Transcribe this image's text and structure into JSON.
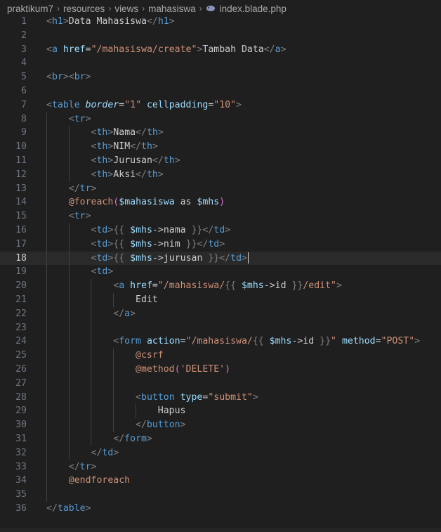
{
  "breadcrumb": {
    "items": [
      "praktikum7",
      "resources",
      "views",
      "mahasiswa"
    ],
    "file": "index.blade.php",
    "file_icon": "php-elephant-icon"
  },
  "editor": {
    "current_line": 18,
    "lines": [
      {
        "n": "1",
        "tokens": [
          [
            "p",
            "<"
          ],
          [
            "t",
            "h1"
          ],
          [
            "p",
            ">"
          ],
          [
            "x",
            "Data Mahasiswa"
          ],
          [
            "p",
            "</"
          ],
          [
            "t",
            "h1"
          ],
          [
            "p",
            ">"
          ]
        ]
      },
      {
        "n": "2",
        "tokens": []
      },
      {
        "n": "3",
        "tokens": [
          [
            "p",
            "<"
          ],
          [
            "t",
            "a"
          ],
          [
            "x",
            " "
          ],
          [
            "a",
            "href"
          ],
          [
            "x",
            "="
          ],
          [
            "s",
            "\"/mahasiswa/create\""
          ],
          [
            "p",
            ">"
          ],
          [
            "x",
            "Tambah Data"
          ],
          [
            "p",
            "</"
          ],
          [
            "t",
            "a"
          ],
          [
            "p",
            ">"
          ]
        ]
      },
      {
        "n": "4",
        "tokens": []
      },
      {
        "n": "5",
        "tokens": [
          [
            "p",
            "<"
          ],
          [
            "t",
            "br"
          ],
          [
            "p",
            "><"
          ],
          [
            "t",
            "br"
          ],
          [
            "p",
            ">"
          ]
        ]
      },
      {
        "n": "6",
        "tokens": []
      },
      {
        "n": "7",
        "tokens": [
          [
            "p",
            "<"
          ],
          [
            "t",
            "table"
          ],
          [
            "x",
            " "
          ],
          [
            "ai",
            "border"
          ],
          [
            "x",
            "="
          ],
          [
            "s",
            "\"1\""
          ],
          [
            "x",
            " "
          ],
          [
            "a",
            "cellpadding"
          ],
          [
            "x",
            "="
          ],
          [
            "s",
            "\"10\""
          ],
          [
            "p",
            ">"
          ]
        ]
      },
      {
        "n": "8",
        "tokens": [
          [
            "x",
            "    "
          ],
          [
            "p",
            "<"
          ],
          [
            "t",
            "tr"
          ],
          [
            "p",
            ">"
          ]
        ]
      },
      {
        "n": "9",
        "tokens": [
          [
            "x",
            "        "
          ],
          [
            "p",
            "<"
          ],
          [
            "t",
            "th"
          ],
          [
            "p",
            ">"
          ],
          [
            "x",
            "Nama"
          ],
          [
            "p",
            "</"
          ],
          [
            "t",
            "th"
          ],
          [
            "p",
            ">"
          ]
        ]
      },
      {
        "n": "10",
        "tokens": [
          [
            "x",
            "        "
          ],
          [
            "p",
            "<"
          ],
          [
            "t",
            "th"
          ],
          [
            "p",
            ">"
          ],
          [
            "x",
            "NIM"
          ],
          [
            "p",
            "</"
          ],
          [
            "t",
            "th"
          ],
          [
            "p",
            ">"
          ]
        ]
      },
      {
        "n": "11",
        "tokens": [
          [
            "x",
            "        "
          ],
          [
            "p",
            "<"
          ],
          [
            "t",
            "th"
          ],
          [
            "p",
            ">"
          ],
          [
            "x",
            "Jurusan"
          ],
          [
            "p",
            "</"
          ],
          [
            "t",
            "th"
          ],
          [
            "p",
            ">"
          ]
        ]
      },
      {
        "n": "12",
        "tokens": [
          [
            "x",
            "        "
          ],
          [
            "p",
            "<"
          ],
          [
            "t",
            "th"
          ],
          [
            "p",
            ">"
          ],
          [
            "x",
            "Aksi"
          ],
          [
            "p",
            "</"
          ],
          [
            "t",
            "th"
          ],
          [
            "p",
            ">"
          ]
        ]
      },
      {
        "n": "13",
        "tokens": [
          [
            "x",
            "    "
          ],
          [
            "p",
            "</"
          ],
          [
            "t",
            "tr"
          ],
          [
            "p",
            ">"
          ]
        ]
      },
      {
        "n": "14",
        "tokens": [
          [
            "x",
            "    "
          ],
          [
            "d",
            "@foreach"
          ],
          [
            "br",
            "("
          ],
          [
            "v",
            "$mahasiswa"
          ],
          [
            "x",
            " as "
          ],
          [
            "v",
            "$mhs"
          ],
          [
            "br",
            ")"
          ]
        ]
      },
      {
        "n": "15",
        "tokens": [
          [
            "x",
            "    "
          ],
          [
            "p",
            "<"
          ],
          [
            "t",
            "tr"
          ],
          [
            "p",
            ">"
          ]
        ]
      },
      {
        "n": "16",
        "tokens": [
          [
            "x",
            "        "
          ],
          [
            "p",
            "<"
          ],
          [
            "t",
            "td"
          ],
          [
            "p",
            ">"
          ],
          [
            "p",
            "{{"
          ],
          [
            "x",
            " "
          ],
          [
            "v",
            "$mhs"
          ],
          [
            "x",
            "->nama "
          ],
          [
            "p",
            "}}"
          ],
          [
            "p",
            "</"
          ],
          [
            "t",
            "td"
          ],
          [
            "p",
            ">"
          ]
        ]
      },
      {
        "n": "17",
        "tokens": [
          [
            "x",
            "        "
          ],
          [
            "p",
            "<"
          ],
          [
            "t",
            "td"
          ],
          [
            "p",
            ">"
          ],
          [
            "p",
            "{{"
          ],
          [
            "x",
            " "
          ],
          [
            "v",
            "$mhs"
          ],
          [
            "x",
            "->nim "
          ],
          [
            "p",
            "}}"
          ],
          [
            "p",
            "</"
          ],
          [
            "t",
            "td"
          ],
          [
            "p",
            ">"
          ]
        ]
      },
      {
        "n": "18",
        "tokens": [
          [
            "x",
            "        "
          ],
          [
            "p",
            "<"
          ],
          [
            "t",
            "td"
          ],
          [
            "p",
            ">"
          ],
          [
            "p",
            "{{"
          ],
          [
            "x",
            " "
          ],
          [
            "v",
            "$mhs"
          ],
          [
            "x",
            "->jurusan "
          ],
          [
            "p",
            "}}"
          ],
          [
            "p",
            "</"
          ],
          [
            "t",
            "td"
          ],
          [
            "p",
            ">"
          ]
        ]
      },
      {
        "n": "19",
        "tokens": [
          [
            "x",
            "        "
          ],
          [
            "p",
            "<"
          ],
          [
            "t",
            "td"
          ],
          [
            "p",
            ">"
          ]
        ]
      },
      {
        "n": "20",
        "tokens": [
          [
            "x",
            "            "
          ],
          [
            "p",
            "<"
          ],
          [
            "t",
            "a"
          ],
          [
            "x",
            " "
          ],
          [
            "a",
            "href"
          ],
          [
            "x",
            "="
          ],
          [
            "s",
            "\"/mahasiswa/"
          ],
          [
            "p",
            "{{"
          ],
          [
            "x",
            " "
          ],
          [
            "v",
            "$mhs"
          ],
          [
            "x",
            "->id "
          ],
          [
            "p",
            "}}"
          ],
          [
            "s",
            "/edit\""
          ],
          [
            "p",
            ">"
          ]
        ]
      },
      {
        "n": "21",
        "tokens": [
          [
            "x",
            "                Edit"
          ]
        ]
      },
      {
        "n": "22",
        "tokens": [
          [
            "x",
            "            "
          ],
          [
            "p",
            "</"
          ],
          [
            "t",
            "a"
          ],
          [
            "p",
            ">"
          ]
        ]
      },
      {
        "n": "23",
        "tokens": []
      },
      {
        "n": "24",
        "tokens": [
          [
            "x",
            "            "
          ],
          [
            "p",
            "<"
          ],
          [
            "t",
            "form"
          ],
          [
            "x",
            " "
          ],
          [
            "a",
            "action"
          ],
          [
            "x",
            "="
          ],
          [
            "s",
            "\"/mahasiswa/"
          ],
          [
            "p",
            "{{"
          ],
          [
            "x",
            " "
          ],
          [
            "v",
            "$mhs"
          ],
          [
            "x",
            "->id "
          ],
          [
            "p",
            "}}"
          ],
          [
            "s",
            "\""
          ],
          [
            "x",
            " "
          ],
          [
            "a",
            "method"
          ],
          [
            "x",
            "="
          ],
          [
            "s",
            "\"POST\""
          ],
          [
            "p",
            ">"
          ]
        ]
      },
      {
        "n": "25",
        "tokens": [
          [
            "x",
            "                "
          ],
          [
            "d",
            "@csrf"
          ]
        ]
      },
      {
        "n": "26",
        "tokens": [
          [
            "x",
            "                "
          ],
          [
            "d",
            "@method"
          ],
          [
            "br",
            "("
          ],
          [
            "s",
            "'DELETE'"
          ],
          [
            "br",
            ")"
          ]
        ]
      },
      {
        "n": "27",
        "tokens": []
      },
      {
        "n": "28",
        "tokens": [
          [
            "x",
            "                "
          ],
          [
            "p",
            "<"
          ],
          [
            "t",
            "button"
          ],
          [
            "x",
            " "
          ],
          [
            "a",
            "type"
          ],
          [
            "x",
            "="
          ],
          [
            "s",
            "\"submit\""
          ],
          [
            "p",
            ">"
          ]
        ]
      },
      {
        "n": "29",
        "tokens": [
          [
            "x",
            "                    Hapus"
          ]
        ]
      },
      {
        "n": "30",
        "tokens": [
          [
            "x",
            "                "
          ],
          [
            "p",
            "</"
          ],
          [
            "t",
            "button"
          ],
          [
            "p",
            ">"
          ]
        ]
      },
      {
        "n": "31",
        "tokens": [
          [
            "x",
            "            "
          ],
          [
            "p",
            "</"
          ],
          [
            "t",
            "form"
          ],
          [
            "p",
            ">"
          ]
        ]
      },
      {
        "n": "32",
        "tokens": [
          [
            "x",
            "        "
          ],
          [
            "p",
            "</"
          ],
          [
            "t",
            "td"
          ],
          [
            "p",
            ">"
          ]
        ]
      },
      {
        "n": "33",
        "tokens": [
          [
            "x",
            "    "
          ],
          [
            "p",
            "</"
          ],
          [
            "t",
            "tr"
          ],
          [
            "p",
            ">"
          ]
        ]
      },
      {
        "n": "34",
        "tokens": [
          [
            "x",
            "    "
          ],
          [
            "d",
            "@endforeach"
          ]
        ]
      },
      {
        "n": "35",
        "tokens": []
      },
      {
        "n": "36",
        "tokens": [
          [
            "p",
            "</"
          ],
          [
            "t",
            "table"
          ],
          [
            "p",
            ">"
          ]
        ]
      }
    ]
  }
}
